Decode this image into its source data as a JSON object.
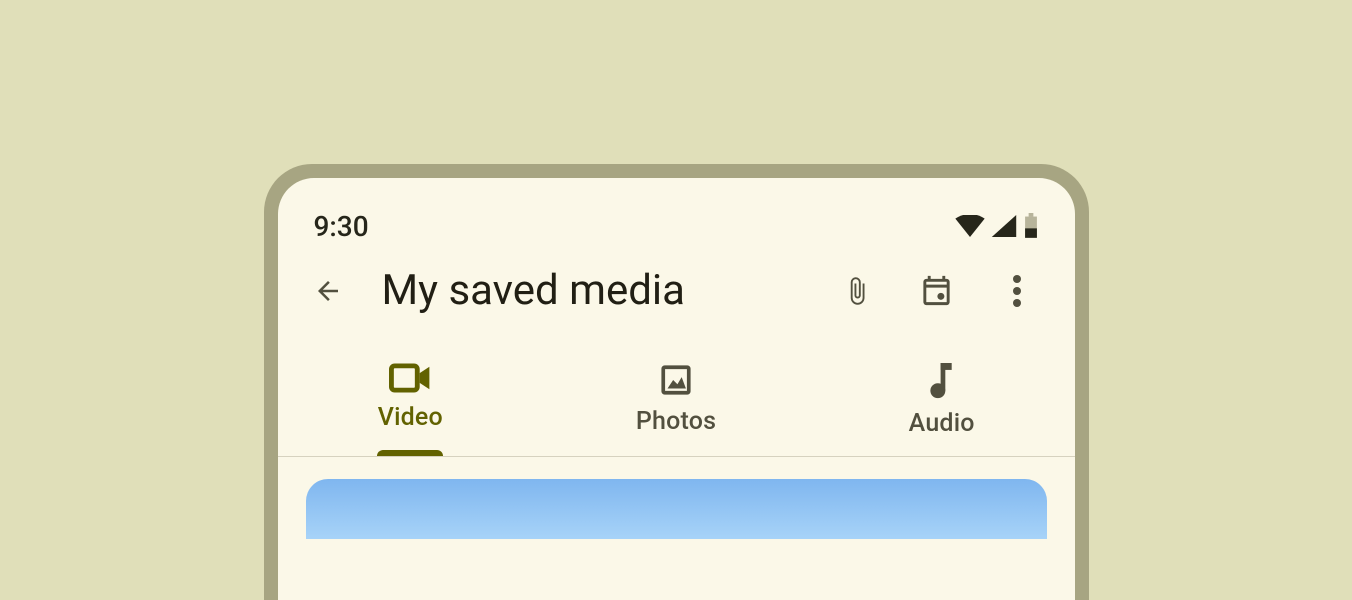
{
  "status": {
    "time": "9:30",
    "icons": {
      "wifi": "wifi-icon",
      "signal": "signal-icon",
      "battery": "battery-icon"
    }
  },
  "topbar": {
    "title": "My saved media",
    "actions": {
      "back": "arrow-back-icon",
      "attach": "attachment-icon",
      "calendar": "calendar-icon",
      "more": "more-vert-icon"
    }
  },
  "tabs": [
    {
      "label": "Video",
      "icon": "videocam-icon",
      "active": true
    },
    {
      "label": "Photos",
      "icon": "image-icon",
      "active": false
    },
    {
      "label": "Audio",
      "icon": "music-note-icon",
      "active": false
    }
  ],
  "colors": {
    "accent": "#626200",
    "muted": "#52503f",
    "surface": "#fbf8e8"
  }
}
